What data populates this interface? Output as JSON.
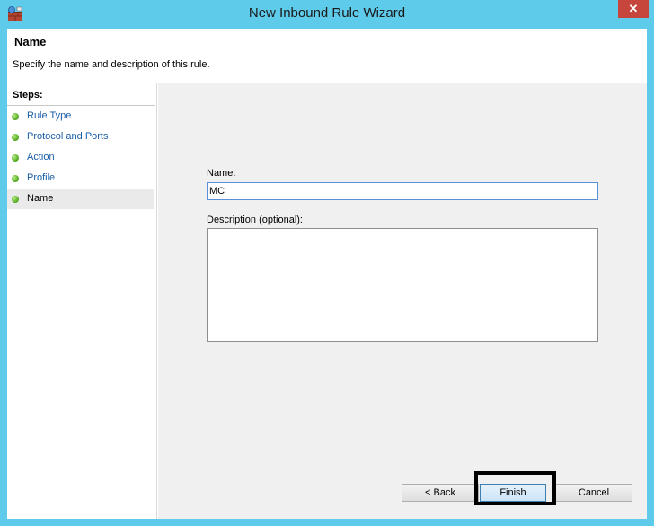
{
  "window": {
    "title": "New Inbound Rule Wizard",
    "close_glyph": "✕"
  },
  "header": {
    "title": "Name",
    "description": "Specify the name and description of this rule."
  },
  "steps": {
    "heading": "Steps:",
    "items": [
      {
        "label": "Rule Type"
      },
      {
        "label": "Protocol and Ports"
      },
      {
        "label": "Action"
      },
      {
        "label": "Profile"
      },
      {
        "label": "Name"
      }
    ],
    "current_index": 4
  },
  "form": {
    "name_label": "Name:",
    "name_value": "MC",
    "description_label": "Description (optional):",
    "description_value": ""
  },
  "buttons": {
    "back": "< Back",
    "finish": "Finish",
    "cancel": "Cancel"
  },
  "colors": {
    "frame": "#5ecbea",
    "link": "#1a5ea8",
    "close": "#c7463c",
    "step_dot": "#5fb42c",
    "content_bg": "#f0f0f0"
  }
}
